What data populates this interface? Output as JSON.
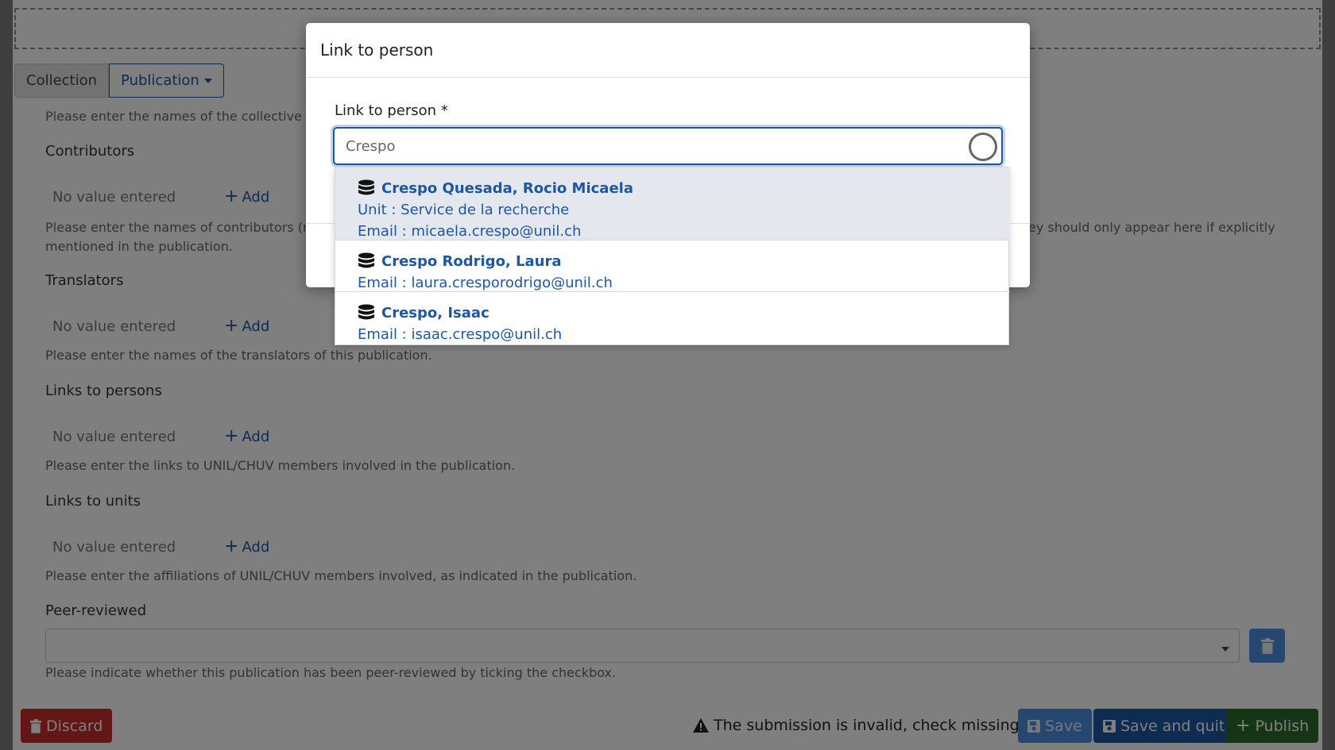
{
  "tabs": {
    "collection": "Collection",
    "publication": "Publication"
  },
  "sections": {
    "collective_help": "Please enter the names of the collective auth",
    "contributors": {
      "title": "Contributors",
      "no_value": "No value entered",
      "add": "Add",
      "help_left": "Please enter the names of contributors (memb",
      "help_right": "ey should only appear here if explicitly",
      "help_line2": "mentioned in the publication."
    },
    "translators": {
      "title": "Translators",
      "no_value": "No value entered",
      "add": "Add",
      "help": "Please enter the names of the translators of this publication."
    },
    "links_persons": {
      "title": "Links to persons",
      "no_value": "No value entered",
      "add": "Add",
      "help": "Please enter the links to UNIL/CHUV members involved in the publication."
    },
    "links_units": {
      "title": "Links to units",
      "no_value": "No value entered",
      "add": "Add",
      "help": "Please enter the affiliations of UNIL/CHUV members involved, as indicated in the publication."
    },
    "peer_reviewed": {
      "title": "Peer-reviewed",
      "help": "Please indicate whether this publication has been peer-reviewed by ticking the checkbox."
    }
  },
  "footer": {
    "discard": "Discard",
    "invalid_message": "The submission is invalid, check missing fields",
    "save": "Save",
    "save_and_quit": "Save and quit",
    "publish": "Publish"
  },
  "modal": {
    "title": "Link to person",
    "field_label": "Link to person *",
    "input_value": "Crespo"
  },
  "options": [
    {
      "name": "Crespo Quesada, Rocio Micaela",
      "unit": "Unit : Service de la recherche",
      "email": "Email : micaela.crespo@unil.ch"
    },
    {
      "name": "Crespo Rodrigo, Laura",
      "email": "Email : laura.cresporodrigo@unil.ch"
    },
    {
      "name": "Crespo, Isaac",
      "email": "Email : isaac.crespo@unil.ch"
    }
  ],
  "colors": {
    "primary": "#1d57a4",
    "danger": "#c42c2c",
    "success": "#2b6b2b",
    "light_primary": "#4d8fe0"
  }
}
